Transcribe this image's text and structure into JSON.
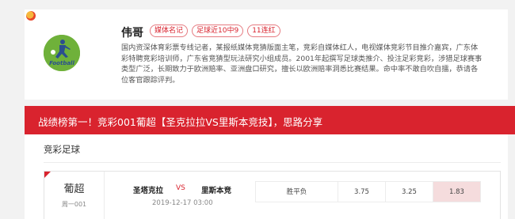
{
  "profile": {
    "name": "伟哥",
    "badges": [
      "媒体名记",
      "足球近10中9",
      "11连红"
    ],
    "bio": "国内资深体育彩票专线记者，某报纸媒体竞猜版面主笔，竞彩自媒体红人，电视媒体竞彩节目推介嘉宾，广东体彩特聘竞彩培训师，广东省竞猜型玩法研究小组成员。2001年起撰写足球类推介、投注足彩竞彩，涉猎足球赛事类型广泛，长期致力于欧洲赔率、亚洲盘口研究，擅长以欧洲赔率洞悉比赛结果。命中率不敢自吹自擂，恭请各位客官跟踪评判。",
    "avatar_text": "Football"
  },
  "banner": {
    "title": "战绩榜第一！竞彩001葡超【圣克拉拉VS里斯本竞技】，思路分享"
  },
  "section": {
    "title": "竞彩足球"
  },
  "match": {
    "league": "葡超",
    "number": "周一001",
    "home": "圣塔克拉",
    "vs": "VS",
    "away": "里斯本竞",
    "time": "2019-12-17 03:00",
    "bet_type": "胜平负",
    "odds": [
      "3.75",
      "3.25",
      "1.83"
    ],
    "selected_index": 2
  },
  "colors": {
    "accent": "#d9232e",
    "selected_bg": "#f5dcdd",
    "avatar_bg": "#6fb13a"
  }
}
